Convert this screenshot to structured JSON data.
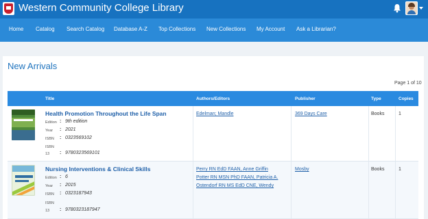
{
  "header": {
    "app_title": "Western Community College Library",
    "notification_icon": "bell-icon",
    "avatar_icon": "user-avatar"
  },
  "nav": {
    "items": [
      {
        "label": "Home"
      },
      {
        "label": "Catalog"
      },
      {
        "label": "Search Catalog"
      },
      {
        "label": "Database A-Z"
      },
      {
        "label": "Top Collections"
      },
      {
        "label": "New Collections"
      },
      {
        "label": "My Account"
      },
      {
        "label": "Ask a Librarian?"
      }
    ]
  },
  "page": {
    "title": "New Arrivals",
    "pagination": "Page 1 of 10"
  },
  "table": {
    "columns": [
      "Title",
      "Authors/Editors",
      "Publisher",
      "Type",
      "Copies"
    ],
    "meta_labels": {
      "edition": "Edition",
      "year": "Year",
      "isbn": "ISBN",
      "isbn13_a": "ISBN",
      "isbn13_b": "13",
      "colon": ":"
    },
    "rows": [
      {
        "title": "Health Promotion Throughout the Life Span",
        "edition": "9th edition",
        "year": "2021",
        "isbn": "0323569102",
        "isbn13": "9780323569101",
        "authors": [
          "Edelman; Mandle"
        ],
        "publisher": "369 Days Care",
        "type": "Books",
        "copies": "1"
      },
      {
        "title": "Nursing Interventions & Clinical Skills",
        "edition": "6",
        "year": "2015",
        "isbn": "0323187943",
        "isbn13": "9780323187947",
        "authors": [
          "Perry RN EdD FAAN, Anne Griffin",
          "Potter RN MSN PhD FAAN, Patricia A.",
          "Ostendorf RN MS EdD CNE, Wendy"
        ],
        "publisher": "Mosby",
        "type": "Books",
        "copies": "1"
      }
    ]
  }
}
